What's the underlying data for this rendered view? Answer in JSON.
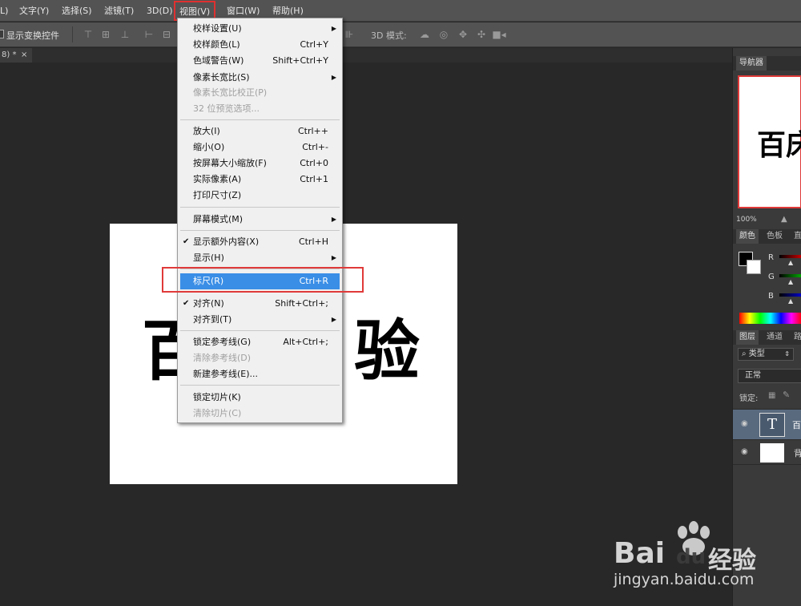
{
  "menubar": {
    "items": [
      {
        "label": "L)"
      },
      {
        "label": "文字(Y)"
      },
      {
        "label": "选择(S)"
      },
      {
        "label": "滤镜(T)"
      },
      {
        "label": "3D(D)"
      },
      {
        "label": "视图(V)"
      },
      {
        "label": "窗口(W)"
      },
      {
        "label": "帮助(H)"
      }
    ]
  },
  "optbar": {
    "show_transform_label": "显示变换控件",
    "mode3d_label": "3D 模式:"
  },
  "doctab": {
    "label": "8) *",
    "close": "×"
  },
  "document": {
    "text_left": "百",
    "text_right": "验"
  },
  "view_menu": {
    "items": [
      {
        "label": "校样设置(U)",
        "shortcut": "",
        "submenu": true
      },
      {
        "label": "校样颜色(L)",
        "shortcut": "Ctrl+Y"
      },
      {
        "label": "色域警告(W)",
        "shortcut": "Shift+Ctrl+Y"
      },
      {
        "label": "像素长宽比(S)",
        "shortcut": "",
        "submenu": true
      },
      {
        "label": "像素长宽比校正(P)",
        "shortcut": "",
        "disabled": true
      },
      {
        "label": "32 位预览选项...",
        "shortcut": "",
        "disabled": true
      },
      {
        "label": "放大(I)",
        "shortcut": "Ctrl++"
      },
      {
        "label": "缩小(O)",
        "shortcut": "Ctrl+-"
      },
      {
        "label": "按屏幕大小缩放(F)",
        "shortcut": "Ctrl+0"
      },
      {
        "label": "实际像素(A)",
        "shortcut": "Ctrl+1"
      },
      {
        "label": "打印尺寸(Z)",
        "shortcut": ""
      },
      {
        "label": "屏幕模式(M)",
        "shortcut": "",
        "submenu": true
      },
      {
        "label": "显示额外内容(X)",
        "shortcut": "Ctrl+H",
        "checked": true
      },
      {
        "label": "显示(H)",
        "shortcut": "",
        "submenu": true
      },
      {
        "label": "标尺(R)",
        "shortcut": "Ctrl+R",
        "highlighted": true
      },
      {
        "label": "对齐(N)",
        "shortcut": "Shift+Ctrl+;",
        "checked": true
      },
      {
        "label": "对齐到(T)",
        "shortcut": "",
        "submenu": true
      },
      {
        "label": "锁定参考线(G)",
        "shortcut": "Alt+Ctrl+;"
      },
      {
        "label": "清除参考线(D)",
        "shortcut": "",
        "disabled": true
      },
      {
        "label": "新建参考线(E)...",
        "shortcut": ""
      },
      {
        "label": "锁定切片(K)",
        "shortcut": ""
      },
      {
        "label": "清除切片(C)",
        "shortcut": "",
        "disabled": true
      }
    ]
  },
  "navigator": {
    "tab": "导航器",
    "preview_text": "百床",
    "zoom": "100%"
  },
  "color_panel": {
    "tabs": [
      "颜色",
      "色板",
      "直"
    ],
    "channels": [
      "R",
      "G",
      "B"
    ]
  },
  "layers_panel": {
    "tabs": [
      "图层",
      "通道",
      "路"
    ],
    "filter_label": "类型",
    "blend_mode": "正常",
    "lock_label": "锁定:",
    "layers": [
      {
        "name": "百",
        "thumb": "T"
      },
      {
        "name": "背",
        "thumb": ""
      }
    ]
  },
  "watermark": {
    "brand": "Bai",
    "brand2": "du",
    "brand3": "经验",
    "url": "jingyan.baidu.com"
  },
  "colors": {
    "highlight": "#3a8ee6",
    "annotation_red": "#e03a3a"
  }
}
